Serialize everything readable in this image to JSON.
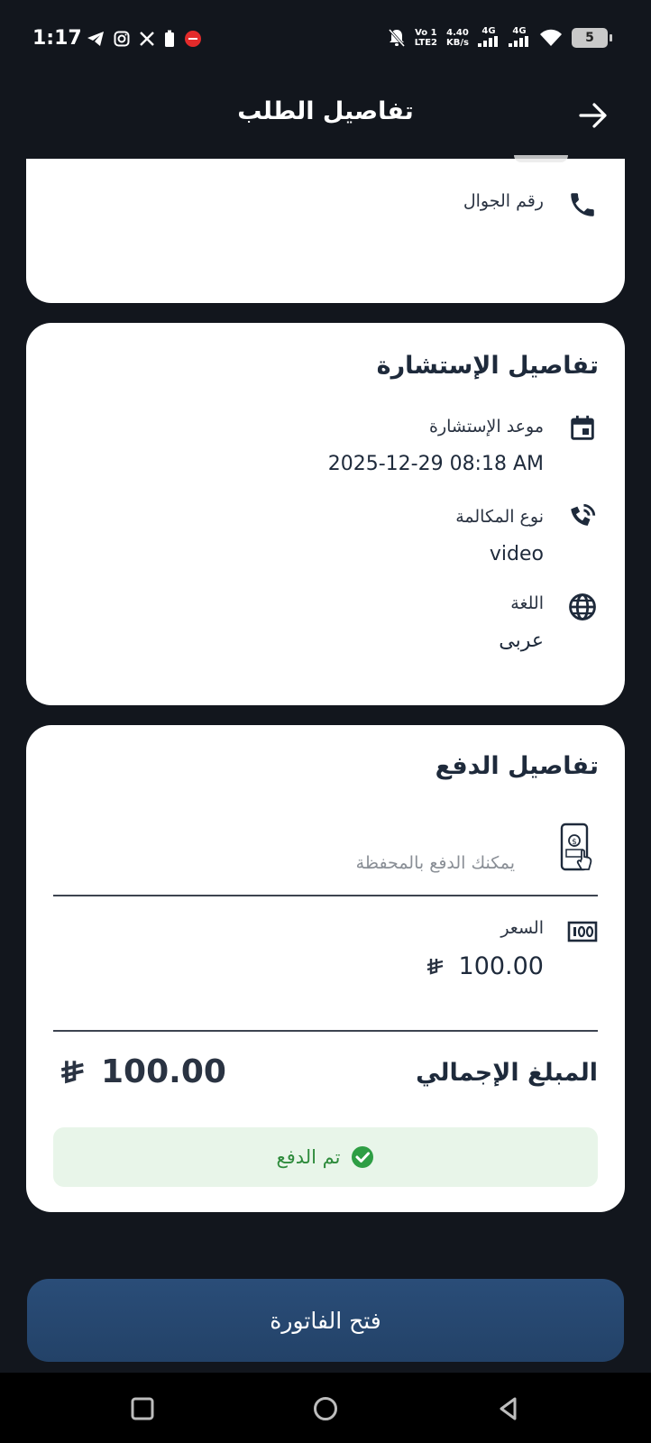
{
  "status_bar": {
    "time": "1:17",
    "network_top": "Vo 1",
    "network_bottom": "LTE2",
    "speed_top": "4.40",
    "speed_bottom": "KB/s",
    "signal1": "4G",
    "signal2": "4G",
    "battery": "5"
  },
  "header": {
    "title": "تفاصيل الطلب",
    "back_icon": "arrow-right-icon"
  },
  "contact_card": {
    "phone_label": "رقم الجوال",
    "phone_icon": "phone-icon"
  },
  "consultation": {
    "title": "تفاصيل الإستشارة",
    "date_label": "موعد الإستشارة",
    "date_value": "2025-12-29  08:18 AM",
    "call_type_label": "نوع المكالمة",
    "call_type_value": "video",
    "language_label": "اللغة",
    "language_value": "عربى"
  },
  "payment": {
    "title": "تفاصيل الدفع",
    "wallet_text": "يمكنك الدفع بالمحفظة",
    "price_label": "السعر",
    "price_value": "100.00",
    "total_label": "المبلغ الإجمالي",
    "total_value": "100.00",
    "paid_text": "تم الدفع",
    "paid_color": "#2e8b3c"
  },
  "actions": {
    "invoice_button": "فتح الفاتورة"
  },
  "colors": {
    "background": "#12161d",
    "card": "#ffffff",
    "primary": "#2a4d78",
    "text": "#1e2a3b"
  }
}
